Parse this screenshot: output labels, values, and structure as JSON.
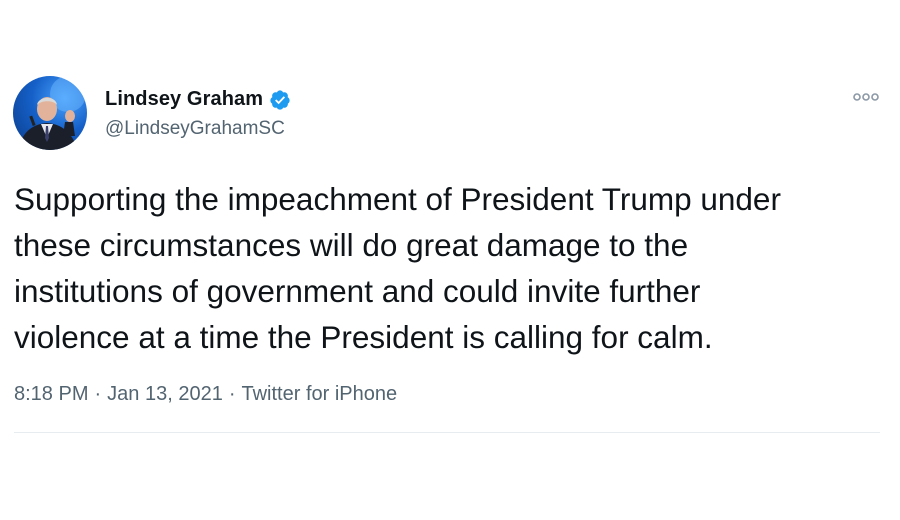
{
  "author": {
    "display_name": "Lindsey Graham",
    "handle": "@LindseyGrahamSC",
    "verified": true,
    "verified_color": "#1d9bf0",
    "avatar_icon": "profile-photo"
  },
  "tweet": {
    "text": "Supporting the impeachment of President Trump under\nthese circumstances will do great damage to the\ninstitutions of government and could invite further\nviolence at a time the President is calling for calm."
  },
  "meta": {
    "time": "8:18 PM",
    "separator": "·",
    "date": "Jan 13, 2021",
    "source": "Twitter for iPhone"
  },
  "icons": {
    "more": "more-options-icon",
    "verified": "verified-badge-icon"
  },
  "colors": {
    "text_primary": "#0f1419",
    "text_secondary": "#536471",
    "divider": "#e6ecf0"
  }
}
